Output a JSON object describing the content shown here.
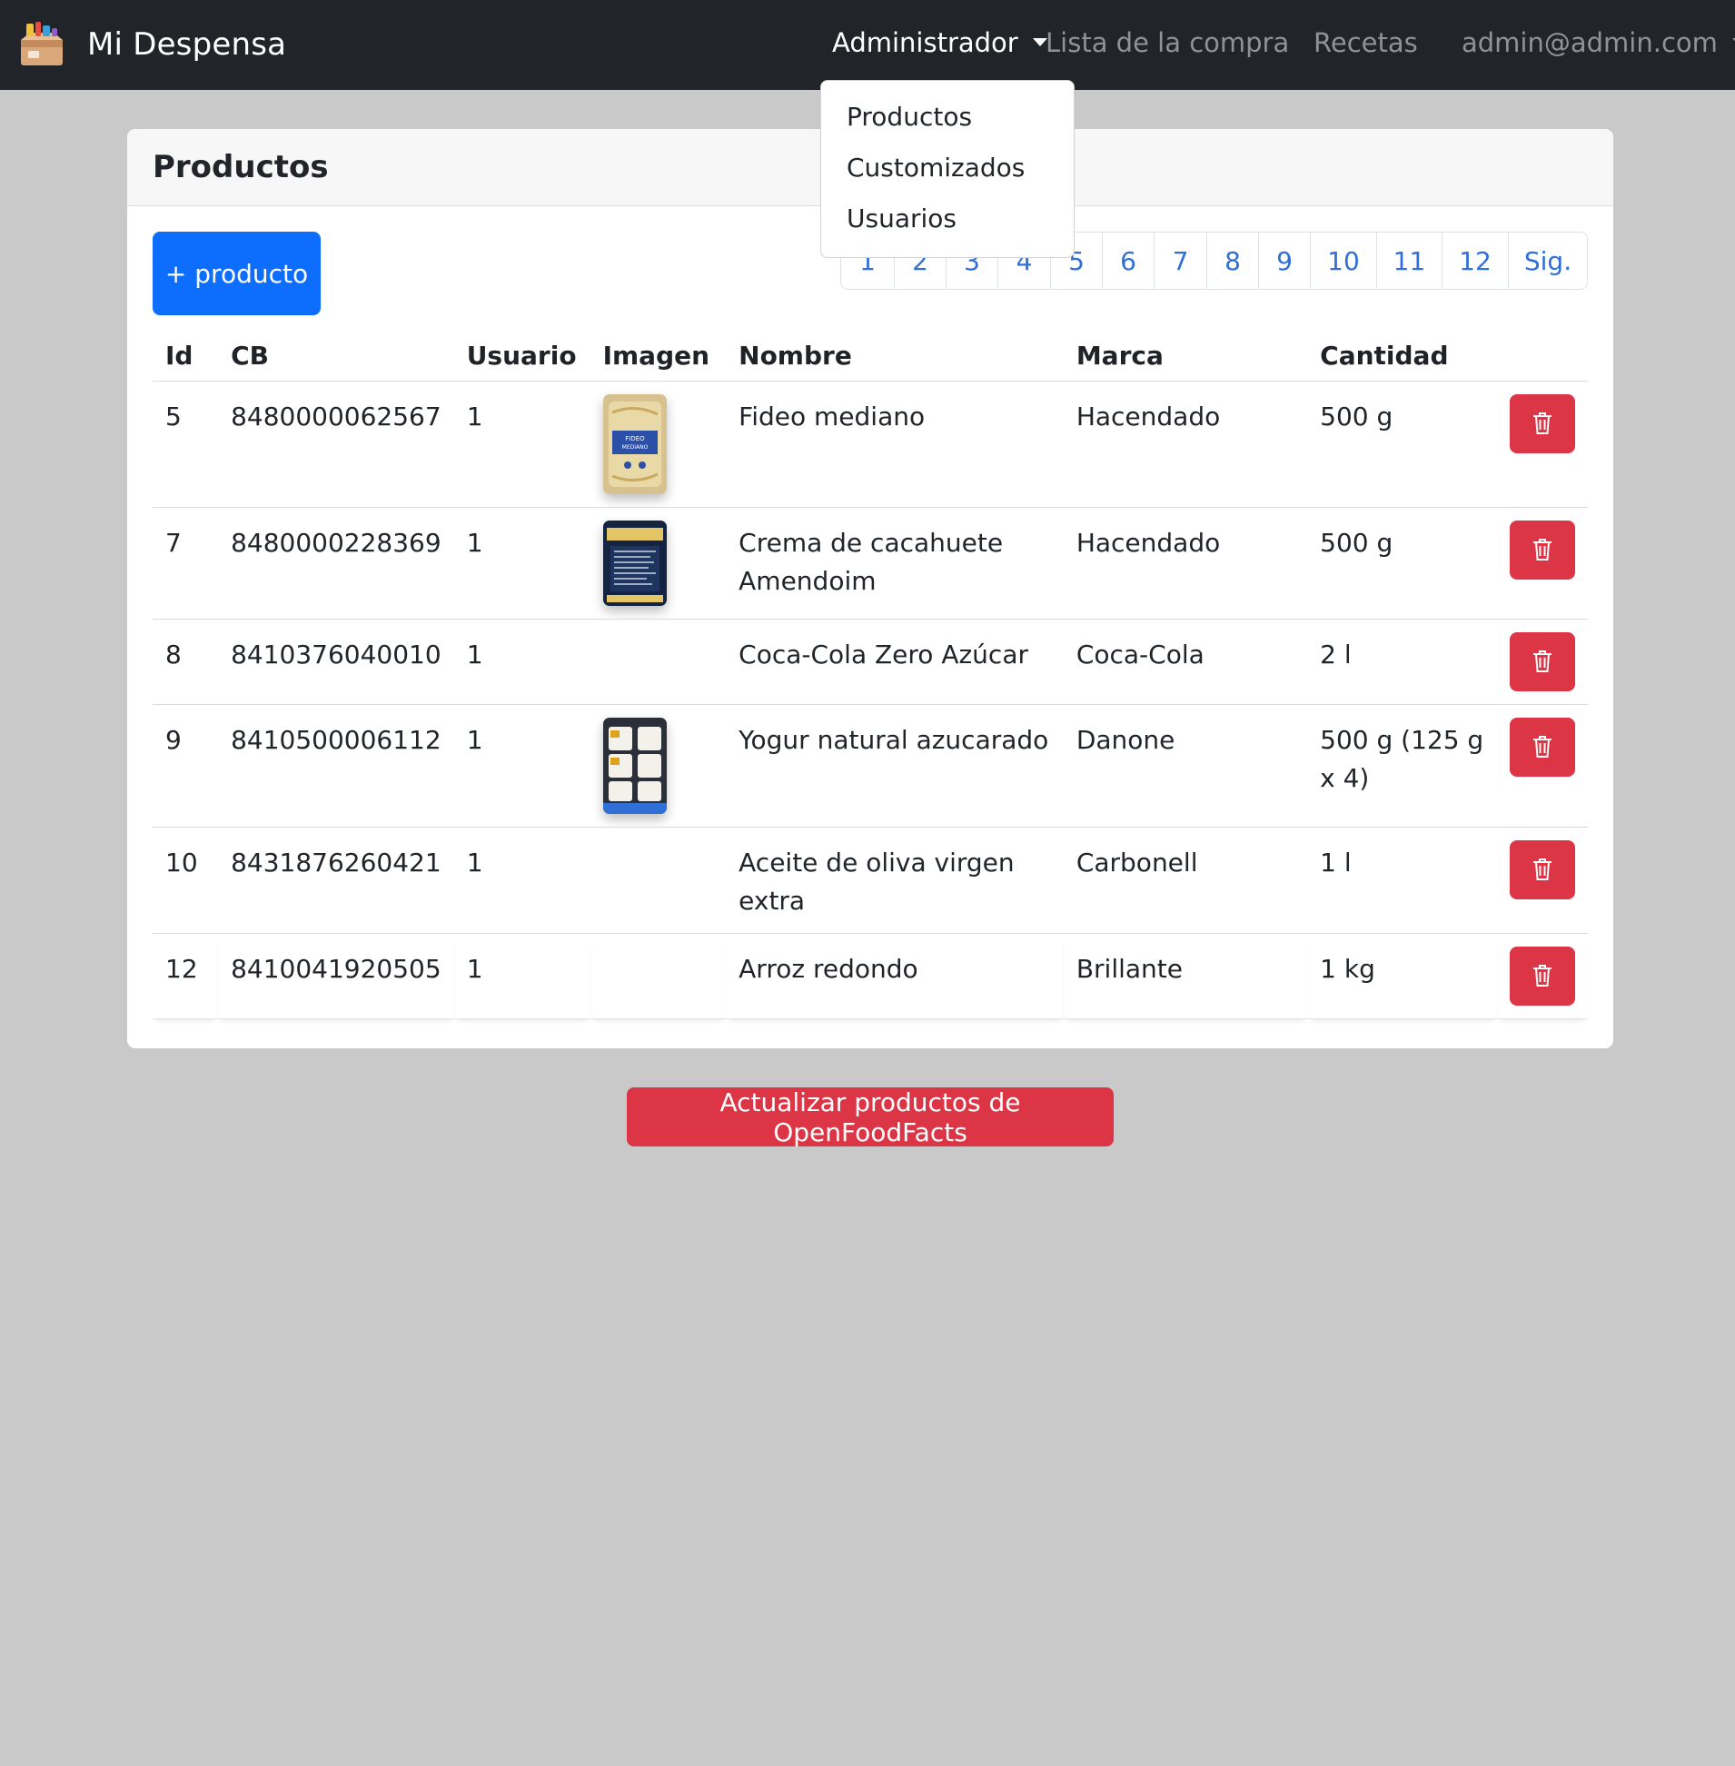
{
  "navbar": {
    "brand": "Mi Despensa",
    "admin_menu": "Administrador",
    "shopping_list": "Lista de la compra",
    "recipes": "Recetas",
    "user_menu": "admin@admin.com"
  },
  "dropdown": {
    "items": [
      "Productos",
      "Customizados",
      "Usuarios"
    ]
  },
  "card": {
    "title": "Productos",
    "add_button": "+ producto"
  },
  "pagination": [
    "1",
    "2",
    "3",
    "4",
    "5",
    "6",
    "7",
    "8",
    "9",
    "10",
    "11",
    "12",
    "Sig."
  ],
  "table": {
    "headers": [
      "Id",
      "CB",
      "Usuario",
      "Imagen",
      "Nombre",
      "Marca",
      "Cantidad"
    ],
    "rows": [
      {
        "id": "5",
        "cb": "8480000062567",
        "usuario": "1",
        "image": "fideo-image",
        "nombre": "Fideo mediano",
        "marca": "Hacendado",
        "cantidad": "500 g"
      },
      {
        "id": "7",
        "cb": "8480000228369",
        "usuario": "1",
        "image": "crema-image",
        "nombre": "Crema de cacahuete Amendoim",
        "marca": "Hacendado",
        "cantidad": "500 g"
      },
      {
        "id": "8",
        "cb": "8410376040010",
        "usuario": "1",
        "image": "",
        "nombre": "Coca-Cola Zero Azúcar",
        "marca": "Coca-Cola",
        "cantidad": "2 l"
      },
      {
        "id": "9",
        "cb": "8410500006112",
        "usuario": "1",
        "image": "yogur-image",
        "nombre": "Yogur natural azucarado",
        "marca": "Danone",
        "cantidad": "500 g (125 g x 4)"
      },
      {
        "id": "10",
        "cb": "8431876260421",
        "usuario": "1",
        "image": "",
        "nombre": "Aceite de oliva virgen extra",
        "marca": "Carbonell",
        "cantidad": "1 l"
      },
      {
        "id": "12",
        "cb": "8410041920505",
        "usuario": "1",
        "image": "",
        "nombre": "Arroz redondo",
        "marca": "Brillante",
        "cantidad": "1 kg"
      }
    ]
  },
  "footer": {
    "update_button": "Actualizar productos de OpenFoodFacts"
  },
  "colors": {
    "navbar_bg": "#212529",
    "primary": "#0d6efd",
    "danger": "#dc3545",
    "page_bg": "#c9c9c9",
    "link": "#2f6fd6"
  }
}
